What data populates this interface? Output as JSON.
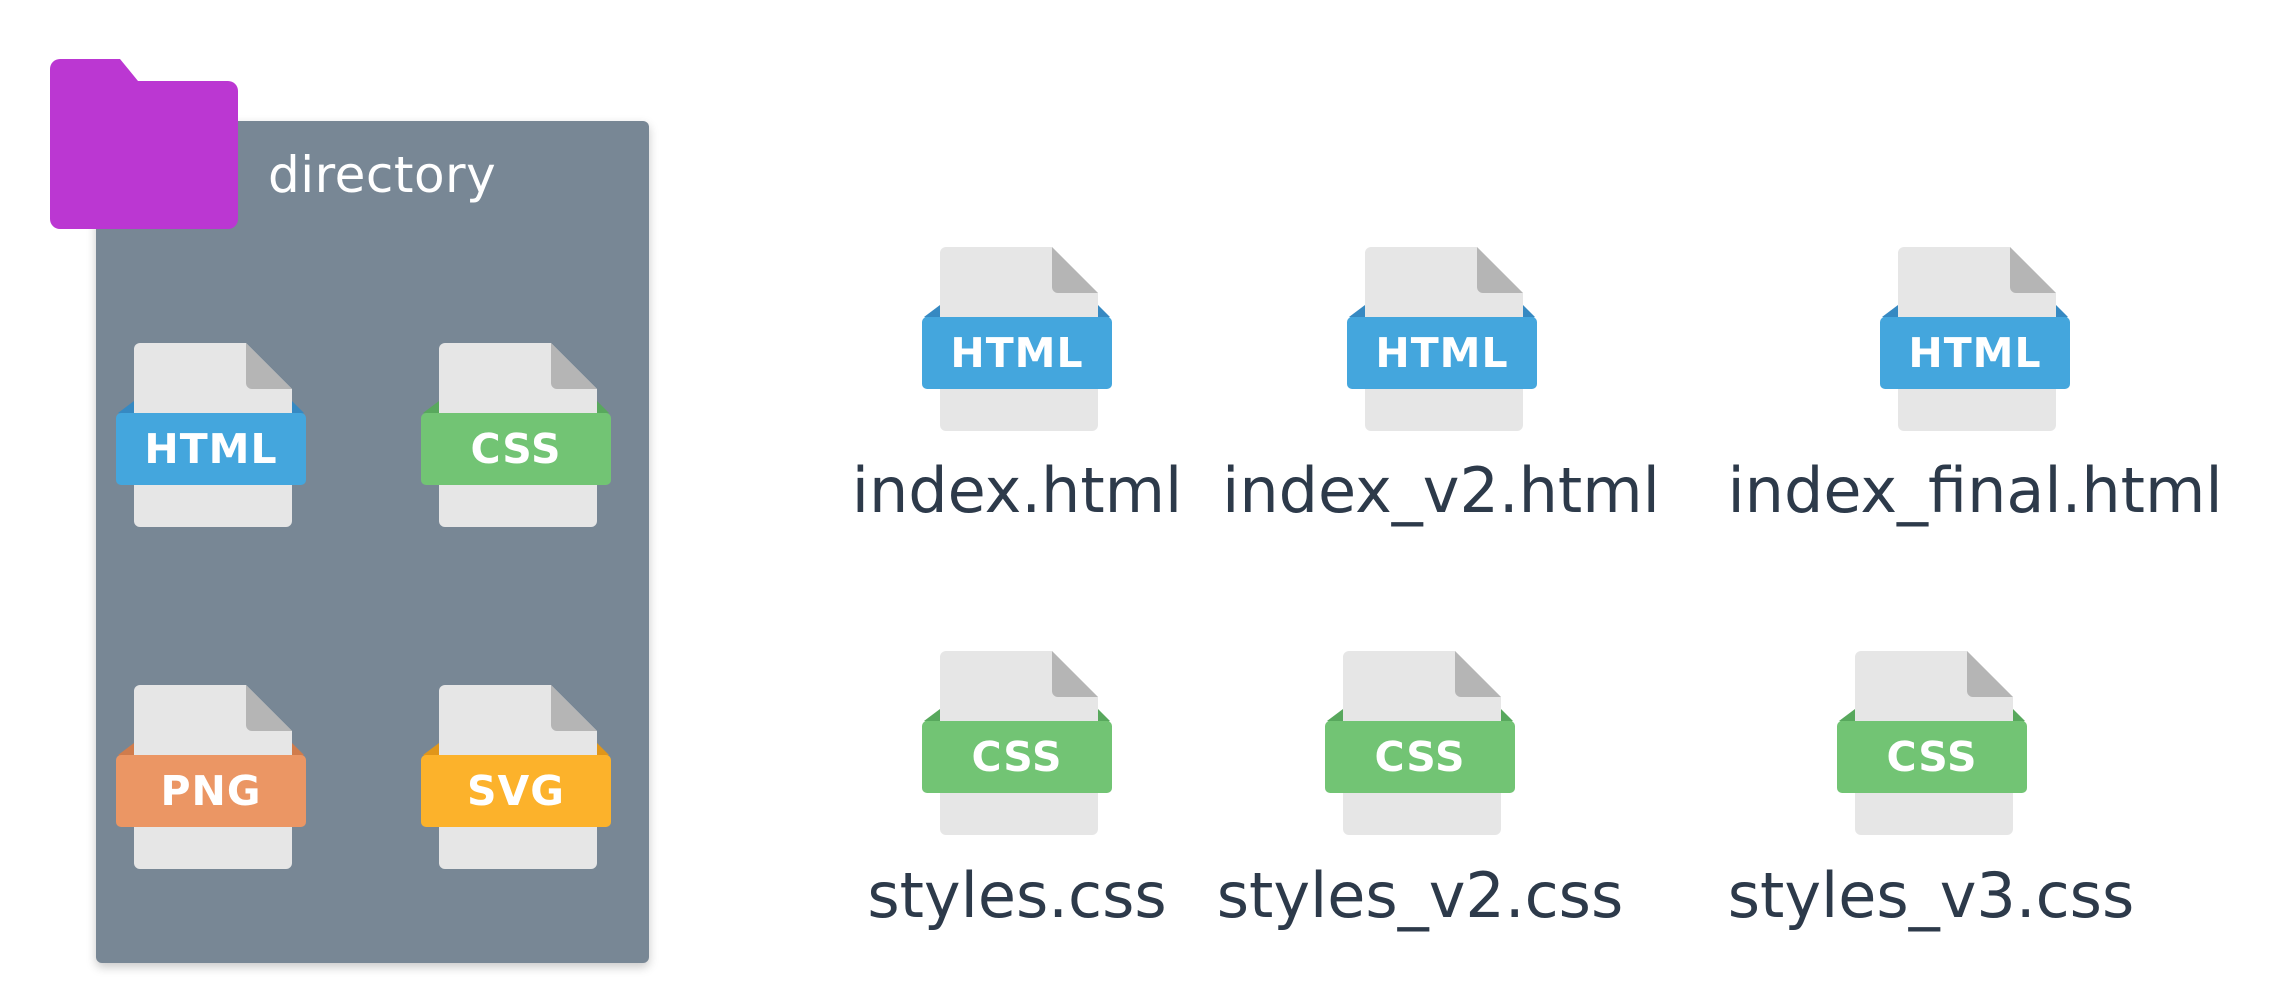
{
  "directory": {
    "label": "directory",
    "folder_color": "#bb37d2",
    "panel_color": "#788795",
    "files": [
      {
        "type": "HTML",
        "color": "#44a6dd",
        "dark": "#3689c2"
      },
      {
        "type": "CSS",
        "color": "#72c474",
        "dark": "#58a85d"
      },
      {
        "type": "PNG",
        "color": "#eb9664",
        "dark": "#d07c4c"
      },
      {
        "type": "SVG",
        "color": "#fcb22b",
        "dark": "#e0961a"
      }
    ]
  },
  "files": [
    {
      "type": "HTML",
      "name": "index.html",
      "color": "#44a6dd",
      "dark": "#3689c2"
    },
    {
      "type": "HTML",
      "name": "index_v2.html",
      "color": "#44a6dd",
      "dark": "#3689c2"
    },
    {
      "type": "HTML",
      "name": "index_final.html",
      "color": "#44a6dd",
      "dark": "#3689c2"
    },
    {
      "type": "CSS",
      "name": "styles.css",
      "color": "#72c474",
      "dark": "#58a85d"
    },
    {
      "type": "CSS",
      "name": "styles_v2.css",
      "color": "#72c474",
      "dark": "#58a85d"
    },
    {
      "type": "CSS",
      "name": "styles_v3.css",
      "color": "#72c474",
      "dark": "#58a85d"
    }
  ],
  "colors": {
    "page_bg": "#ffffff",
    "paper": "#e6e6e6",
    "paper_fold": "#b5b5b5",
    "label_text": "#2d3a4a"
  }
}
